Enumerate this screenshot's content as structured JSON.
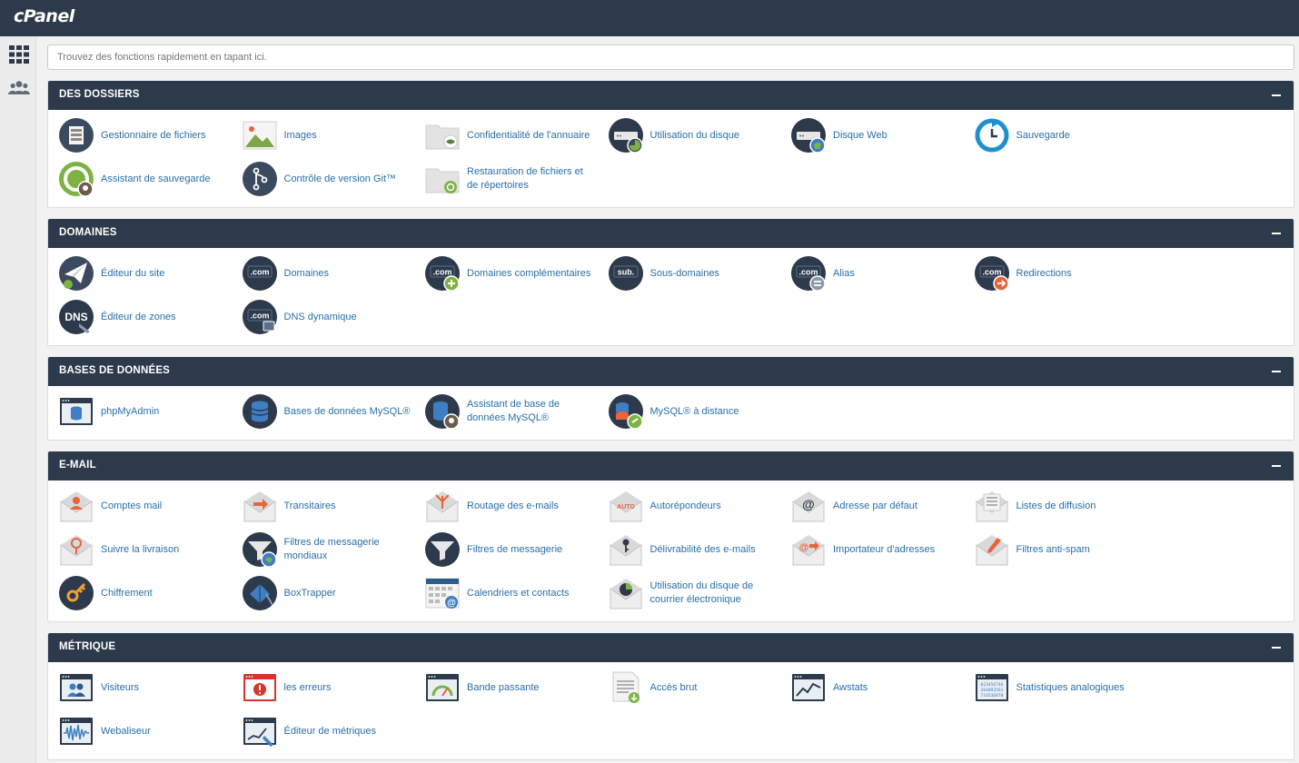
{
  "app": {
    "logo": "cPanel"
  },
  "search": {
    "placeholder": "Trouvez des fonctions rapidement en tapant ici."
  },
  "sections": [
    {
      "title": "DES DOSSIERS",
      "items": [
        {
          "label": "Gestionnaire de fichiers",
          "icon": "file-manager-icon"
        },
        {
          "label": "Images",
          "icon": "images-icon"
        },
        {
          "label": "Confidentialité de l'annuaire",
          "icon": "directory-privacy-icon"
        },
        {
          "label": "Utilisation du disque",
          "icon": "disk-usage-icon"
        },
        {
          "label": "Disque Web",
          "icon": "web-disk-icon"
        },
        {
          "label": "Sauvegarde",
          "icon": "backup-icon"
        },
        {
          "label": "Assistant de sauvegarde",
          "icon": "backup-wizard-icon"
        },
        {
          "label": "Contrôle de version Git™",
          "icon": "git-icon"
        },
        {
          "label": "Restauration de fichiers et de répertoires",
          "icon": "file-restore-icon"
        }
      ]
    },
    {
      "title": "DOMAINES",
      "items": [
        {
          "label": "Éditeur du site",
          "icon": "site-publisher-icon"
        },
        {
          "label": "Domaines",
          "icon": "domains-icon",
          "text": ".com"
        },
        {
          "label": "Domaines complémentaires",
          "icon": "addon-domains-icon",
          "text": ".com"
        },
        {
          "label": "Sous-domaines",
          "icon": "subdomains-icon",
          "text": "sub."
        },
        {
          "label": "Alias",
          "icon": "aliases-icon",
          "text": ".com"
        },
        {
          "label": "Redirections",
          "icon": "redirects-icon",
          "text": ".com"
        },
        {
          "label": "Éditeur de zones",
          "icon": "zone-editor-icon",
          "text": "DNS"
        },
        {
          "label": "DNS dynamique",
          "icon": "dynamic-dns-icon",
          "text": ".com"
        }
      ]
    },
    {
      "title": "BASES DE DONNÉES",
      "items": [
        {
          "label": "phpMyAdmin",
          "icon": "phpmyadmin-icon"
        },
        {
          "label": "Bases de données MySQL®",
          "icon": "mysql-databases-icon"
        },
        {
          "label": "Assistant de base de données MySQL®",
          "icon": "mysql-wizard-icon"
        },
        {
          "label": "MySQL® à distance",
          "icon": "remote-mysql-icon"
        }
      ]
    },
    {
      "title": "E-MAIL",
      "items": [
        {
          "label": "Comptes mail",
          "icon": "email-accounts-icon"
        },
        {
          "label": "Transitaires",
          "icon": "forwarders-icon"
        },
        {
          "label": "Routage des e-mails",
          "icon": "email-routing-icon"
        },
        {
          "label": "Autorépondeurs",
          "icon": "autoresponders-icon",
          "text": "AUTO"
        },
        {
          "label": "Adresse par défaut",
          "icon": "default-address-icon",
          "text": "@"
        },
        {
          "label": "Listes de diffusion",
          "icon": "mailing-lists-icon"
        },
        {
          "label": "Suivre la livraison",
          "icon": "track-delivery-icon"
        },
        {
          "label": "Filtres de messagerie mondiaux",
          "icon": "global-email-filters-icon"
        },
        {
          "label": "Filtres de messagerie",
          "icon": "email-filters-icon"
        },
        {
          "label": "Délivrabilité des e-mails",
          "icon": "email-deliverability-icon"
        },
        {
          "label": "Importateur d'adresses",
          "icon": "address-importer-icon",
          "text": "@"
        },
        {
          "label": "Filtres anti-spam",
          "icon": "spam-filters-icon"
        },
        {
          "label": "Chiffrement",
          "icon": "encryption-icon"
        },
        {
          "label": "BoxTrapper",
          "icon": "boxtrapper-icon"
        },
        {
          "label": "Calendriers et contacts",
          "icon": "calendars-contacts-icon",
          "text": "@"
        },
        {
          "label": "Utilisation du disque de courrier électronique",
          "icon": "email-disk-usage-icon"
        }
      ]
    },
    {
      "title": "MÉTRIQUE",
      "items": [
        {
          "label": "Visiteurs",
          "icon": "visitors-icon"
        },
        {
          "label": "les erreurs",
          "icon": "errors-icon"
        },
        {
          "label": "Bande passante",
          "icon": "bandwidth-icon"
        },
        {
          "label": "Accès brut",
          "icon": "raw-access-icon"
        },
        {
          "label": "Awstats",
          "icon": "awstats-icon"
        },
        {
          "label": "Statistiques analogiques",
          "icon": "analog-stats-icon",
          "lines": [
            "023456746",
            "264892561",
            "714536870"
          ]
        },
        {
          "label": "Webaliseur",
          "icon": "webalizer-icon"
        },
        {
          "label": "Éditeur de métriques",
          "icon": "metrics-editor-icon"
        }
      ]
    }
  ]
}
